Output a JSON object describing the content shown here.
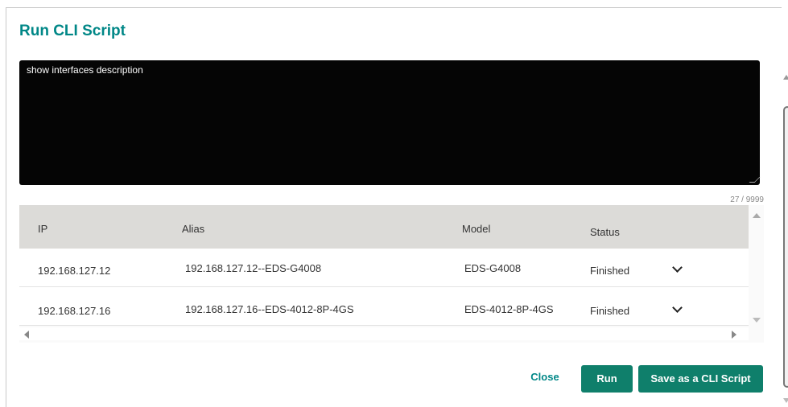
{
  "dialog": {
    "title": "Run CLI Script"
  },
  "editor": {
    "content": "show interfaces description",
    "counter": "27 / 9999"
  },
  "table": {
    "columns": [
      "IP",
      "Alias",
      "Model",
      "Status"
    ],
    "rows": [
      {
        "ip": "192.168.127.12",
        "alias": "192.168.127.12--EDS-G4008",
        "model": "EDS-G4008",
        "status": "Finished"
      },
      {
        "ip": "192.168.127.16",
        "alias": "192.168.127.16--EDS-4012-8P-4GS",
        "model": "EDS-4012-8P-4GS",
        "status": "Finished"
      }
    ]
  },
  "footer": {
    "close_label": "Close",
    "run_label": "Run",
    "save_label": "Save as a CLI Script"
  },
  "colors": {
    "accent": "#008787",
    "button": "#0f7f6b"
  }
}
